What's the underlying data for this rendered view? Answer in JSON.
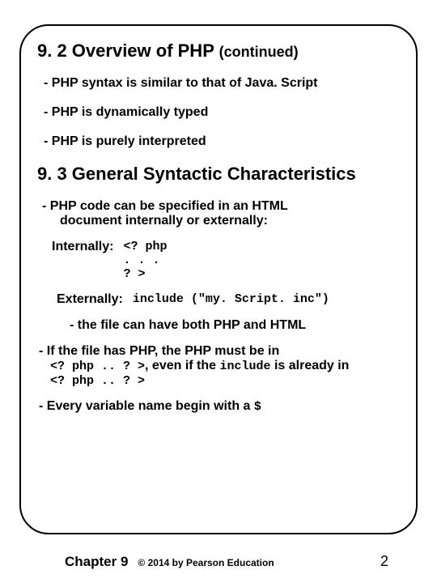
{
  "section1": {
    "title": "9. 2 Overview of PHP ",
    "titleSuffix": "(continued)",
    "b1": "- PHP syntax is similar to that of Java. Script",
    "b2": "- PHP is dynamically typed",
    "b3": "- PHP is purely interpreted"
  },
  "section2": {
    "title": "9. 3 General Syntactic Characteristics",
    "b1a": "- PHP code can be specified in an HTML",
    "b1b": "document internally or externally:",
    "internalLabel": "Internally:",
    "internalCode": "<? php\n. . .\n? >",
    "externalLabel": "Externally:",
    "externalCode": "include (\"my. Script. inc\")",
    "sub": "- the file can have both PHP and HTML",
    "p2a": "- If the file has PHP, the PHP must be in ",
    "p2code1": "<? php .. ? >",
    "p2mid": ", even if the ",
    "p2code2": "include",
    "p2end": " is already in ",
    "p2code3": "<? php .. ? >",
    "p3a": "- Every variable name begin with a ",
    "p3code": "$"
  },
  "footer": {
    "chapter": "Chapter 9",
    "copy": "© 2014 by Pearson Education",
    "page": "2"
  }
}
